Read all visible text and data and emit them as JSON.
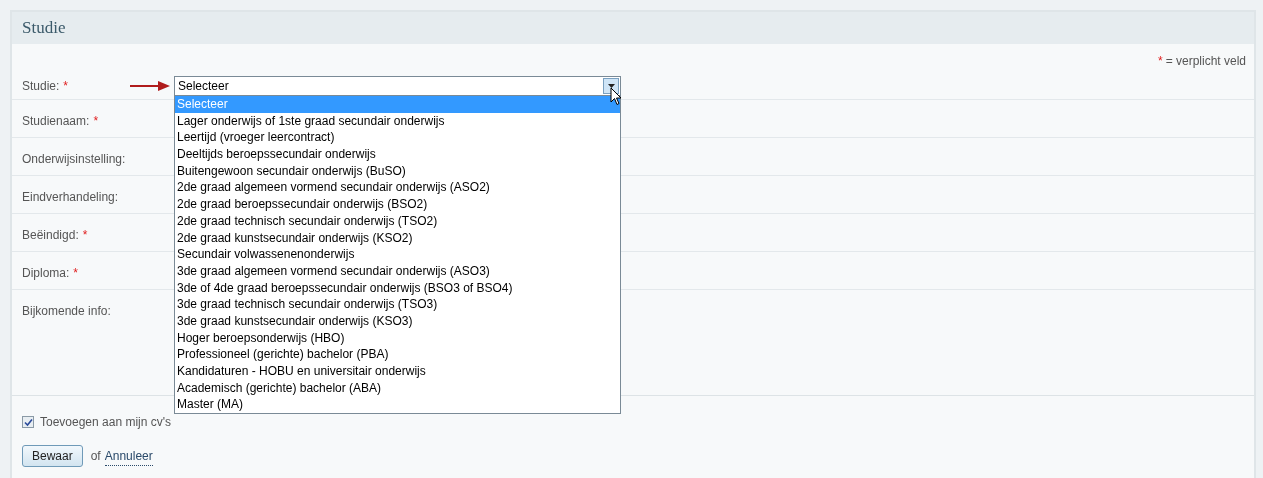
{
  "panel": {
    "title": "Studie"
  },
  "required_note": {
    "mark": "*",
    "text": "= verplicht veld"
  },
  "fields": [
    {
      "label": "Studie:",
      "required": true,
      "kind": "select"
    },
    {
      "label": "Studienaam:",
      "required": true,
      "kind": "plain"
    },
    {
      "label": "Onderwijsinstelling:",
      "required": false,
      "kind": "plain"
    },
    {
      "label": "Eindverhandeling:",
      "required": false,
      "kind": "plain"
    },
    {
      "label": "Beëindigd:",
      "required": true,
      "kind": "plain"
    },
    {
      "label": "Diploma:",
      "required": true,
      "kind": "plain"
    },
    {
      "label": "Bijkomende info:",
      "required": false,
      "kind": "tall"
    }
  ],
  "select": {
    "value": "Selecteer",
    "expanded": true,
    "options": [
      {
        "label": "Selecteer",
        "selected": true
      },
      {
        "label": "Lager onderwijs of 1ste graad secundair onderwijs",
        "selected": false
      },
      {
        "label": "Leertijd (vroeger leercontract)",
        "selected": false
      },
      {
        "label": "Deeltijds beroepssecundair onderwijs",
        "selected": false
      },
      {
        "label": "Buitengewoon secundair onderwijs (BuSO)",
        "selected": false
      },
      {
        "label": "2de graad algemeen vormend secundair onderwijs (ASO2)",
        "selected": false
      },
      {
        "label": "2de graad beroepssecundair onderwijs (BSO2)",
        "selected": false
      },
      {
        "label": "2de graad technisch secundair onderwijs (TSO2)",
        "selected": false
      },
      {
        "label": "2de graad kunstsecundair onderwijs (KSO2)",
        "selected": false
      },
      {
        "label": "Secundair volwassenenonderwijs",
        "selected": false
      },
      {
        "label": "3de graad algemeen vormend secundair onderwijs (ASO3)",
        "selected": false
      },
      {
        "label": "3de of 4de graad beroepssecundair onderwijs (BSO3 of BSO4)",
        "selected": false
      },
      {
        "label": "3de graad technisch secundair onderwijs (TSO3)",
        "selected": false
      },
      {
        "label": "3de graad kunstsecundair onderwijs (KSO3)",
        "selected": false
      },
      {
        "label": "Hoger beroepsonderwijs (HBO)",
        "selected": false
      },
      {
        "label": "Professioneel (gerichte) bachelor (PBA)",
        "selected": false
      },
      {
        "label": "Kandidaturen - HOBU en universitair onderwijs",
        "selected": false
      },
      {
        "label": "Academisch (gerichte) bachelor (ABA)",
        "selected": false
      },
      {
        "label": "Master (MA)",
        "selected": false
      }
    ]
  },
  "checkbox": {
    "label": "Toevoegen aan mijn cv's",
    "checked": true
  },
  "save_button": "Bewaar",
  "or_text": "of",
  "cancel_link": "Annuleer"
}
